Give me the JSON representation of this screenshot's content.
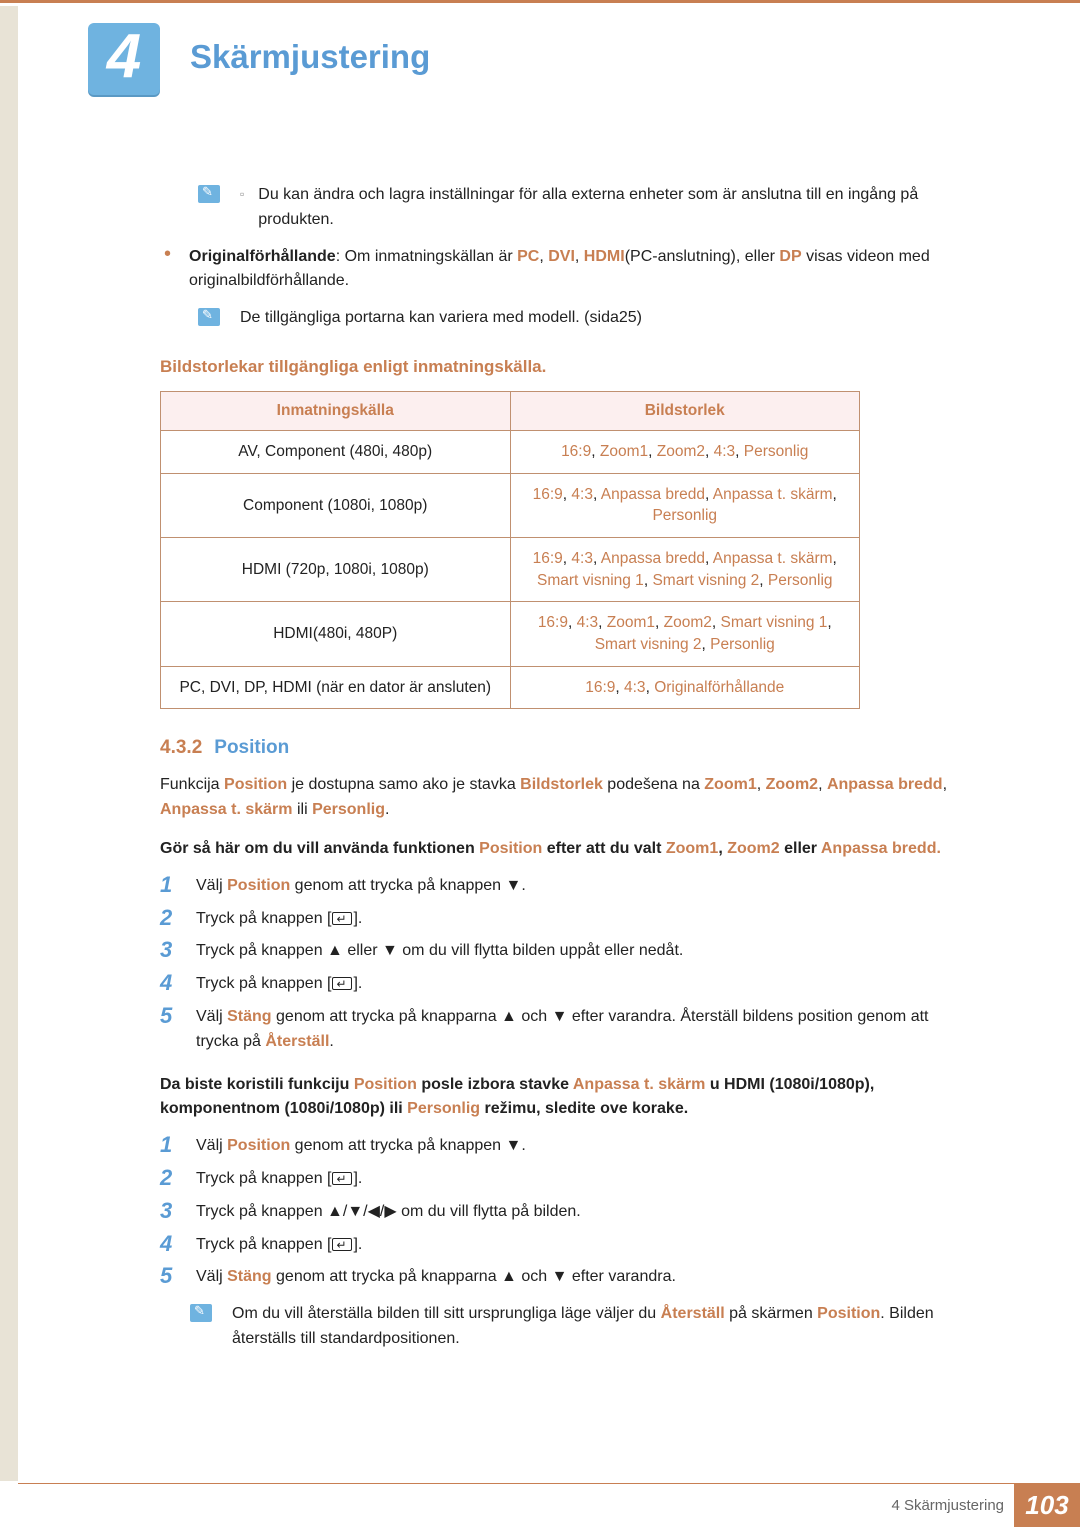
{
  "chapter": {
    "number": "4",
    "title": "Skärmjustering"
  },
  "top_note": "Du kan ändra och lagra inställningar för alla externa enheter som är anslutna till en ingång på produkten.",
  "bullet1": {
    "prefix": "Originalförhållande",
    "txt1": ": Om inmatningskällan är ",
    "pc": "PC",
    "dvi": "DVI",
    "hdmi": "HDMI",
    "txt2": "(PC-anslutning), eller ",
    "dp": "DP",
    "txt3": " visas videon med originalbildförhållande."
  },
  "sub_note1": "De tillgängliga portarna kan variera med modell. (sida25)",
  "table_title": "Bildstorlekar tillgängliga enligt inmatningskälla.",
  "table": {
    "h1": "Inmatningskälla",
    "h2": "Bildstorlek",
    "rows": [
      {
        "src": "AV, Component (480i, 480p)",
        "sz": [
          "16:9",
          "Zoom1",
          "Zoom2",
          "4:3",
          "Personlig"
        ]
      },
      {
        "src": "Component (1080i, 1080p)",
        "sz": [
          "16:9",
          "4:3",
          "Anpassa bredd",
          "Anpassa t. skärm",
          "Personlig"
        ]
      },
      {
        "src": "HDMI (720p, 1080i, 1080p)",
        "sz": [
          "16:9",
          "4:3",
          "Anpassa bredd",
          "Anpassa t. skärm",
          "Smart visning 1",
          "Smart visning 2",
          "Personlig"
        ]
      },
      {
        "src": "HDMI(480i, 480P)",
        "sz": [
          "16:9",
          "4:3",
          "Zoom1",
          "Zoom2",
          " Smart visning 1",
          "Smart visning 2",
          "Personlig"
        ]
      },
      {
        "src": "PC, DVI, DP, HDMI (när en dator är ansluten)",
        "sz": [
          "16:9",
          "4:3",
          "Originalförhållande"
        ]
      }
    ]
  },
  "sec432": {
    "num": "4.3.2",
    "title": "Position"
  },
  "p_funkcija": {
    "a": "Funkcija ",
    "pos": "Position",
    "b": " je dostupna samo ako je stavka ",
    "bs": "Bildstorlek",
    "c": " podešena na ",
    "z1": "Zoom1",
    "z2": "Zoom2",
    "ab": "Anpassa bredd",
    "as": "Anpassa t. skärm",
    "pl": "Personlig",
    "ili": " ili ",
    "dot": "."
  },
  "inst1": {
    "pre": "Gör så här om du vill använda funktionen ",
    "pos": "Position",
    "mid": " efter att du valt ",
    "z1": "Zoom1",
    "z2": "Zoom2",
    "or": " eller ",
    "ab": "Anpassa bredd",
    "dot": "."
  },
  "steps1": {
    "s1a": "Välj ",
    "s1b": "Position",
    "s1c": " genom att trycka på knappen ▼.",
    "s2": "Tryck på knappen [",
    "s2b": "].",
    "s3": "Tryck på knappen ▲ eller ▼ om du vill flytta bilden uppåt eller nedåt.",
    "s4": "Tryck på knappen [",
    "s4b": "].",
    "s5a": "Välj ",
    "s5b": "Stäng",
    "s5c": " genom att trycka på knapparna ▲ och ▼ efter varandra. Återställ bildens position genom att trycka på ",
    "s5d": "Återställ",
    "s5e": "."
  },
  "inst2": {
    "a": "Da biste koristili funkciju ",
    "pos": "Position",
    "b": " posle izbora stavke ",
    "as": "Anpassa t. skärm",
    "c": " u HDMI (1080i/1080p), komponentnom (1080i/1080p) ili ",
    "pl": "Personlig",
    "d": " režimu, sledite ove korake."
  },
  "steps2": {
    "s1a": "Välj ",
    "s1b": "Position",
    "s1c": " genom att trycka på knappen ▼.",
    "s2": "Tryck på knappen [",
    "s2b": "].",
    "s3": "Tryck på knappen ▲/▼/◀/▶ om du vill flytta på bilden.",
    "s4": "Tryck på knappen [",
    "s4b": "].",
    "s5a": "Välj ",
    "s5b": "Stäng",
    "s5c": " genom att trycka på knapparna ▲ och ▼ efter varandra."
  },
  "bottom_note": {
    "a": "Om du vill återställa bilden till sitt ursprungliga läge väljer du ",
    "r": "Återställ",
    "b": " på skärmen ",
    "p": "Position",
    "c": ". Bilden återställs till standardpositionen."
  },
  "footer": {
    "label": "4 Skärmjustering",
    "page": "103"
  }
}
